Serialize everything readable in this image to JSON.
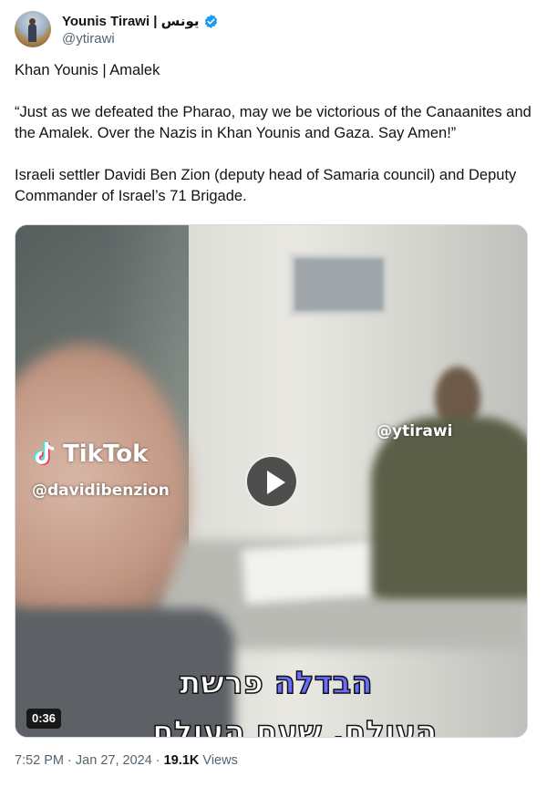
{
  "author": {
    "display_name": "Younis Tirawi | يونس",
    "handle": "@ytirawi",
    "verified_color": "#1d9bf0"
  },
  "tweet": {
    "lines": [
      "Khan Younis | Amalek",
      "“Just as we defeated the Pharao, may we be victorious of the Canaanites and the Amalek. Over the Nazis in Khan Younis and Gaza. Say Amen!”",
      "Israeli settler Davidi Ben Zion (deputy head of Samaria council) and Deputy Commander of Israel’s 71 Brigade."
    ]
  },
  "media": {
    "tiktok_logo_text": "TikTok",
    "tiktok_handle": "@davidibenzion",
    "watermark": "@ytirawi",
    "caption_line1_plain": "פרשת",
    "caption_line1_highlight": "הבדלה",
    "caption_line2": "העולם, שעם העולם",
    "duration": "0:36",
    "play_icon": "play-icon"
  },
  "meta": {
    "time": "7:52 PM",
    "date": "Jan 27, 2024",
    "separator": "·",
    "views_count": "19.1K",
    "views_label": "Views"
  }
}
